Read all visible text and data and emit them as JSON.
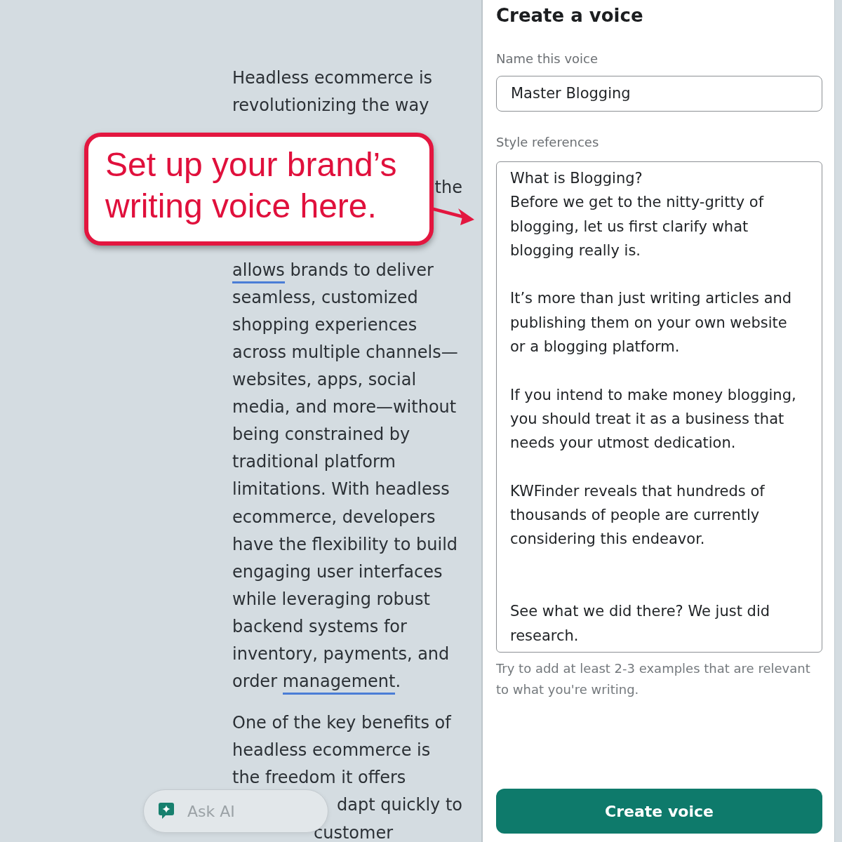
{
  "article": {
    "paragraphs": [
      {
        "lines": [
          {
            "kind": "full",
            "segments": [
              {
                "kind": "plain",
                "text": "Headless ecommerce is"
              }
            ]
          },
          {
            "kind": "full",
            "segments": [
              {
                "kind": "plain",
                "text": "revolutionizing the way"
              }
            ]
          },
          {
            "kind": "tail-after-gap",
            "segments": [
              {
                "kind": "plain",
                "text": "the"
              }
            ]
          },
          {
            "kind": "full-after-gap",
            "segments": [
              {
                "kind": "suggestion",
                "text": "allows"
              },
              {
                "kind": "plain",
                "text": " brands to deliver"
              }
            ]
          },
          {
            "kind": "full",
            "segments": [
              {
                "kind": "plain",
                "text": "seamless, customized"
              }
            ]
          },
          {
            "kind": "full",
            "segments": [
              {
                "kind": "plain",
                "text": "shopping experiences"
              }
            ]
          },
          {
            "kind": "full",
            "segments": [
              {
                "kind": "plain",
                "text": "across multiple channels—"
              }
            ]
          },
          {
            "kind": "full",
            "segments": [
              {
                "kind": "plain",
                "text": "websites, apps, social"
              }
            ]
          },
          {
            "kind": "full",
            "segments": [
              {
                "kind": "plain",
                "text": "media, and more—without"
              }
            ]
          },
          {
            "kind": "full",
            "segments": [
              {
                "kind": "plain",
                "text": "being constrained by"
              }
            ]
          },
          {
            "kind": "full",
            "segments": [
              {
                "kind": "plain",
                "text": "traditional platform"
              }
            ]
          },
          {
            "kind": "full",
            "segments": [
              {
                "kind": "plain",
                "text": "limitations. With headless"
              }
            ]
          },
          {
            "kind": "full",
            "segments": [
              {
                "kind": "plain",
                "text": "ecommerce, developers"
              }
            ]
          },
          {
            "kind": "full",
            "segments": [
              {
                "kind": "plain",
                "text": "have the flexibility to build"
              }
            ]
          },
          {
            "kind": "full",
            "segments": [
              {
                "kind": "plain",
                "text": "engaging user interfaces"
              }
            ]
          },
          {
            "kind": "full",
            "segments": [
              {
                "kind": "plain",
                "text": "while leveraging robust"
              }
            ]
          },
          {
            "kind": "full",
            "segments": [
              {
                "kind": "plain",
                "text": "backend systems for"
              }
            ]
          },
          {
            "kind": "full",
            "segments": [
              {
                "kind": "plain",
                "text": "inventory, payments, and"
              }
            ]
          },
          {
            "kind": "full",
            "segments": [
              {
                "kind": "plain",
                "text": "order "
              },
              {
                "kind": "suggestion",
                "text": "management"
              },
              {
                "kind": "plain",
                "text": "."
              }
            ]
          }
        ]
      },
      {
        "lines": [
          {
            "kind": "full",
            "segments": [
              {
                "kind": "plain",
                "text": "One of the key benefits of"
              }
            ]
          },
          {
            "kind": "full",
            "segments": [
              {
                "kind": "plain",
                "text": "headless ecommerce is"
              }
            ]
          },
          {
            "kind": "full",
            "segments": [
              {
                "kind": "plain",
                "text": "the freedom it offers"
              }
            ]
          },
          {
            "kind": "tail",
            "segments": [
              {
                "kind": "plain",
                "text": "dapt quickly to"
              }
            ]
          },
          {
            "kind": "offset",
            "segments": [
              {
                "kind": "plain",
                "text": "customer"
              }
            ]
          }
        ]
      }
    ]
  },
  "callout": {
    "text": "Set up your brand’s writing voice here."
  },
  "ask_ai": {
    "label": "Ask AI"
  },
  "panel": {
    "title": "Create a voice",
    "name_field": {
      "label": "Name this voice",
      "value": "Master Blogging"
    },
    "style_field": {
      "label": "Style references",
      "value": "What is Blogging?\nBefore we get to the nitty-gritty of blogging, let us first clarify what blogging really is.\n\nIt’s more than just writing articles and publishing them on your own website or a blogging platform.\n\nIf you intend to make money blogging, you should treat it as a business that needs your utmost dedication.\n\nKWFinder reveals that hundreds of thousands of people are currently considering this endeavor.\n\n\nSee what we did there? We just did research."
    },
    "hint": "Try to add at least 2-3 examples that are relevant to what you're writing.",
    "button": "Create voice"
  }
}
